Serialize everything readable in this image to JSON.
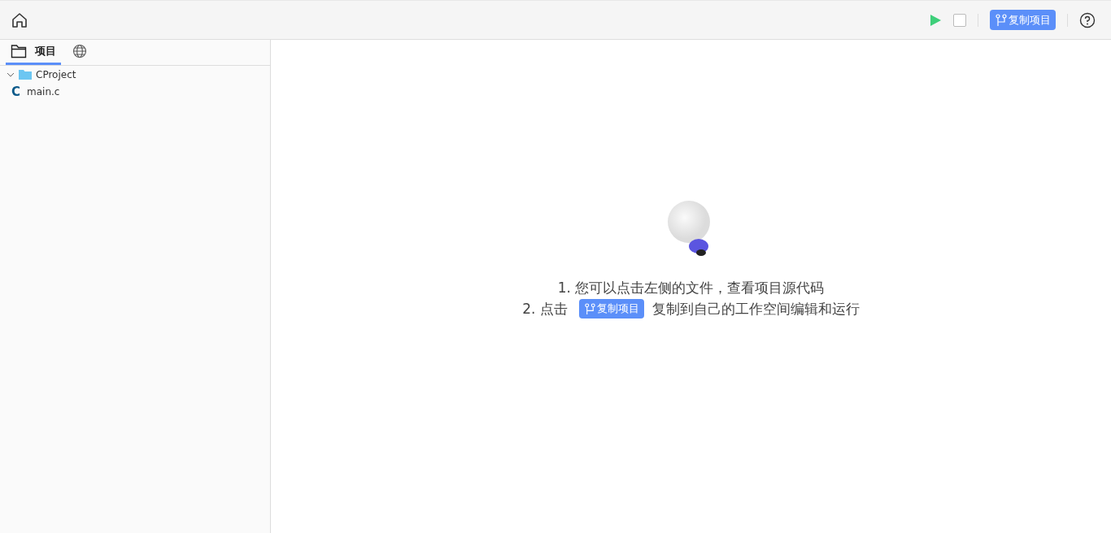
{
  "toolbar": {
    "copy_button": "复制项目"
  },
  "sidebar": {
    "tabs": [
      {
        "kind": "project",
        "label": "项目",
        "selected": true
      },
      {
        "kind": "web",
        "selected": false
      }
    ],
    "tree": [
      {
        "kind": "folder",
        "name": "CProject",
        "expanded": true,
        "children": [
          {
            "kind": "c-file",
            "icon": "C",
            "name": "main.c"
          }
        ]
      }
    ]
  },
  "hint": {
    "line_1": "1. 您可以点击左侧的文件，查看项目源代码",
    "line_2_prefix": "2. 点击",
    "line_2_button": "复制项目",
    "line_2_suffix": "复制到自己的工作空间编辑和运行"
  }
}
